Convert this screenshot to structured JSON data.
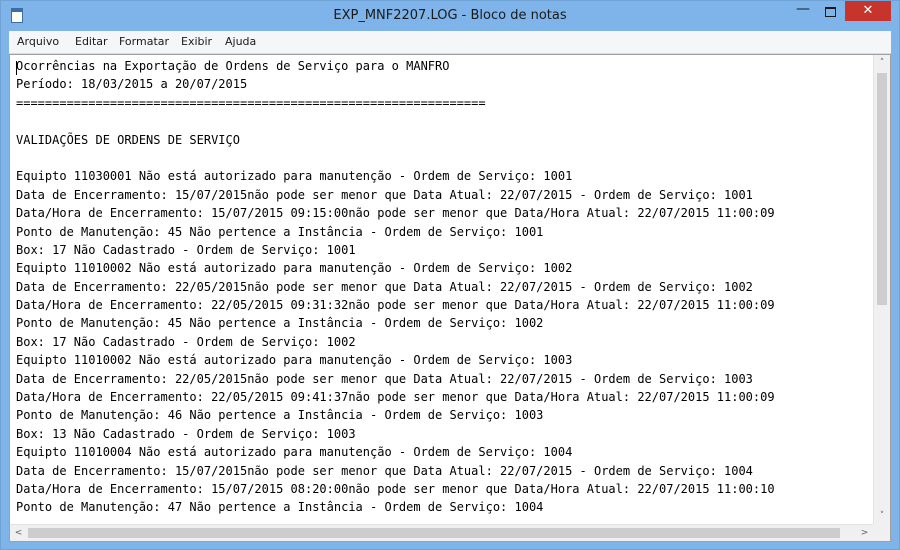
{
  "window": {
    "title": "EXP_MNF2207.LOG - Bloco de notas",
    "minimize_glyph": "—",
    "close_glyph": "✕",
    "accent": "#7eb4ea",
    "close_color": "#c7342c"
  },
  "menu": {
    "items": [
      "Arquivo",
      "Editar",
      "Formatar",
      "Exibir",
      "Ajuda"
    ]
  },
  "document": {
    "lines": [
      "Ocorrências na Exportação de Ordens de Serviço para o MANFRO",
      "Período: 18/03/2015 a 20/07/2015",
      "=================================================================",
      "",
      "VALIDAÇÕES DE ORDENS DE SERVIÇO",
      "",
      "Equipto 11030001 Não está autorizado para manutenção - Ordem de Serviço: 1001",
      "Data de Encerramento: 15/07/2015não pode ser menor que Data Atual: 22/07/2015 - Ordem de Serviço: 1001",
      "Data/Hora de Encerramento: 15/07/2015 09:15:00não pode ser menor que Data/Hora Atual: 22/07/2015 11:00:09",
      "Ponto de Manutenção: 45 Não pertence a Instância - Ordem de Serviço: 1001",
      "Box: 17 Não Cadastrado - Ordem de Serviço: 1001",
      "Equipto 11010002 Não está autorizado para manutenção - Ordem de Serviço: 1002",
      "Data de Encerramento: 22/05/2015não pode ser menor que Data Atual: 22/07/2015 - Ordem de Serviço: 1002",
      "Data/Hora de Encerramento: 22/05/2015 09:31:32não pode ser menor que Data/Hora Atual: 22/07/2015 11:00:09",
      "Ponto de Manutenção: 45 Não pertence a Instância - Ordem de Serviço: 1002",
      "Box: 17 Não Cadastrado - Ordem de Serviço: 1002",
      "Equipto 11010002 Não está autorizado para manutenção - Ordem de Serviço: 1003",
      "Data de Encerramento: 22/05/2015não pode ser menor que Data Atual: 22/07/2015 - Ordem de Serviço: 1003",
      "Data/Hora de Encerramento: 22/05/2015 09:41:37não pode ser menor que Data/Hora Atual: 22/07/2015 11:00:09",
      "Ponto de Manutenção: 46 Não pertence a Instância - Ordem de Serviço: 1003",
      "Box: 13 Não Cadastrado - Ordem de Serviço: 1003",
      "Equipto 11010004 Não está autorizado para manutenção - Ordem de Serviço: 1004",
      "Data de Encerramento: 15/07/2015não pode ser menor que Data Atual: 22/07/2015 - Ordem de Serviço: 1004",
      "Data/Hora de Encerramento: 15/07/2015 08:20:00não pode ser menor que Data/Hora Atual: 22/07/2015 11:00:10",
      "Ponto de Manutenção: 47 Não pertence a Instância - Ordem de Serviço: 1004"
    ]
  },
  "scrollbars": {
    "up_glyph": "˄",
    "down_glyph": "˅",
    "left_glyph": "<",
    "right_glyph": ">"
  }
}
